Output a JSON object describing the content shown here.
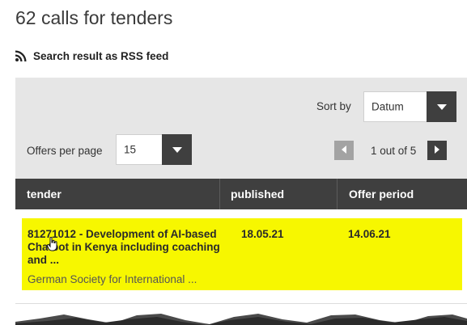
{
  "page": {
    "title": "62 calls for tenders",
    "rss_label": "Search result as RSS feed"
  },
  "filters": {
    "sort_by_label": "Sort by",
    "sort_by_value": "Datum",
    "offers_per_page_label": "Offers per page",
    "offers_per_page_value": "15",
    "pagination": {
      "indicator": "1 out of 5",
      "current_page": 1,
      "total_pages": 5
    }
  },
  "table": {
    "columns": [
      "tender",
      "published",
      "Offer period"
    ],
    "rows": [
      {
        "title": "81271012 - Development of AI-based Chatbot in Kenya including coaching and ...",
        "organization": "German Society for International ...",
        "published": "18.05.21",
        "offer_period": "14.06.21",
        "highlight_color": "#f7f700"
      }
    ]
  },
  "colors": {
    "dark": "#3f3f3f",
    "filter_bg": "#e6e6e6",
    "highlight": "#f7f700",
    "disabled_button": "#a3a3a3"
  },
  "icons": {
    "rss": "rss-icon",
    "dropdown": "chevron-down-icon",
    "prev": "chevron-left-icon",
    "next": "chevron-right-icon",
    "cursor": "hand-cursor-icon"
  }
}
